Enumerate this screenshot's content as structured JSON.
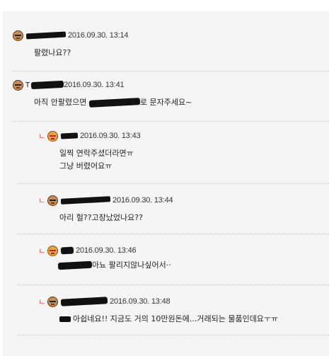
{
  "comments": [
    {
      "author": "",
      "date": "2016.09.30. 13:14",
      "text": "팔렸나요??"
    },
    {
      "author": "T",
      "date": "2016.09.30. 13:41",
      "text_prefix": "아직 안팔렸으면 ",
      "text_suffix": "로 문자주세요~"
    }
  ],
  "replies": [
    {
      "reply_mark": "ㄴ",
      "date": "2016.09.30. 13:43",
      "lines": [
        "일찍 연락주셨더라면ㅠ",
        "그냥 버렸어요ㅠ"
      ]
    },
    {
      "reply_mark": "ㄴ",
      "date": "2016.09.30. 13:44",
      "lines": [
        "아리 헐??고장났었나요??"
      ]
    },
    {
      "reply_mark": "ㄴ",
      "date": "2016.09.30. 13:46",
      "lines": [
        "아뇨 팔리지않나싶어서··"
      ]
    },
    {
      "reply_mark": "ㄴ",
      "date": "2016.09.30. 13:48",
      "lines": [
        "아쉽네요!! 지금도 거의 10만원돈에...거래되는 물품인데요ㅜㅠ"
      ]
    }
  ],
  "icons": {
    "commenter_avatar": "male-character-avatar-icon",
    "reply_avatar_female": "female-character-avatar-icon"
  }
}
